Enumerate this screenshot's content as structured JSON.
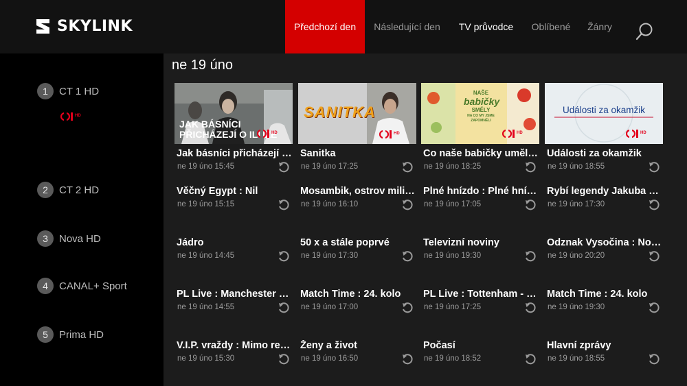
{
  "brand": {
    "name": "SKYLINK"
  },
  "nav": {
    "prev_day": "Předchozí den",
    "next_day": "Následující den",
    "tv_guide": "TV průvodce",
    "favorites": "Oblíbené",
    "genres": "Žánry"
  },
  "colors": {
    "accent": "#d40000",
    "background": "#1c1c1c",
    "sidebar": "#000000",
    "header": "#121212"
  },
  "date_label": "ne 19 úno",
  "channels": [
    {
      "number": "1",
      "name": "CT 1 HD",
      "logo": "ct1hd-logo"
    },
    {
      "number": "2",
      "name": "CT 2 HD"
    },
    {
      "number": "3",
      "name": "Nova HD"
    },
    {
      "number": "4",
      "name": "CANAL+ Sport"
    },
    {
      "number": "5",
      "name": "Prima HD"
    }
  ],
  "thumbnails": {
    "t1": {
      "overlay_line1": "JAK BÁSNÍCI",
      "overlay_line2": "PŘICHÁZEJÍ O ILUZE",
      "logo": "ČT1 HD"
    },
    "t2": {
      "overlay": "SANITKA",
      "logo": "ČT1 HD"
    },
    "t3": {
      "line1": "NAŠE",
      "line2": "babičky",
      "line3": "SMĚLY",
      "line4": "NA CO MY JSME ZAPOMNĚLI",
      "logo": "ČT1 HD"
    },
    "t4": {
      "overlay": "Události za okamžik",
      "logo": "ČT1 HD"
    }
  },
  "programs": [
    [
      {
        "title": "Jak básníci přicházejí o iluze",
        "time": "ne 19 úno 15:45"
      },
      {
        "title": "Sanitka",
        "time": "ne 19 úno 17:25"
      },
      {
        "title": "Co naše babičky uměly a na co my jsme zapomněli",
        "time": "ne 19 úno 18:25"
      },
      {
        "title": "Události za okamžik",
        "time": "ne 19 úno 18:55"
      }
    ],
    [
      {
        "title": "Věčný Egypt : Nil",
        "time": "ne 19 úno 15:15"
      },
      {
        "title": "Mosambik, ostrov milionů",
        "time": "ne 19 úno 16:10"
      },
      {
        "title": "Plné hnízdo : Plné hnízdo",
        "time": "ne 19 úno 17:05"
      },
      {
        "title": "Rybí legendy Jakuba Vágnera",
        "time": "ne 19 úno 17:30"
      }
    ],
    [
      {
        "title": "Jádro",
        "time": "ne 19 úno 14:45"
      },
      {
        "title": "50 x a stále poprvé",
        "time": "ne 19 úno 17:30"
      },
      {
        "title": "Televizní noviny",
        "time": "ne 19 úno 19:30"
      },
      {
        "title": "Odznak Vysočina : Nová mise",
        "time": "ne 19 úno 20:20"
      }
    ],
    [
      {
        "title": "PL Live : Manchester United",
        "time": "ne 19 úno 14:55"
      },
      {
        "title": "Match Time : 24. kolo",
        "time": "ne 19 úno 17:00"
      },
      {
        "title": "PL Live : Tottenham - Chelsea",
        "time": "ne 19 úno 17:25"
      },
      {
        "title": "Match Time : 24. kolo",
        "time": "ne 19 úno 19:30"
      }
    ],
    [
      {
        "title": "V.I.P. vraždy : Mimo rekord",
        "time": "ne 19 úno 15:30"
      },
      {
        "title": "Ženy a život",
        "time": "ne 19 úno 16:50"
      },
      {
        "title": "Počasí",
        "time": "ne 19 úno 18:52"
      },
      {
        "title": "Hlavní zprávy",
        "time": "ne 19 úno 18:55"
      }
    ]
  ],
  "icons": {
    "search": "search-icon",
    "replay": "replay-icon"
  }
}
